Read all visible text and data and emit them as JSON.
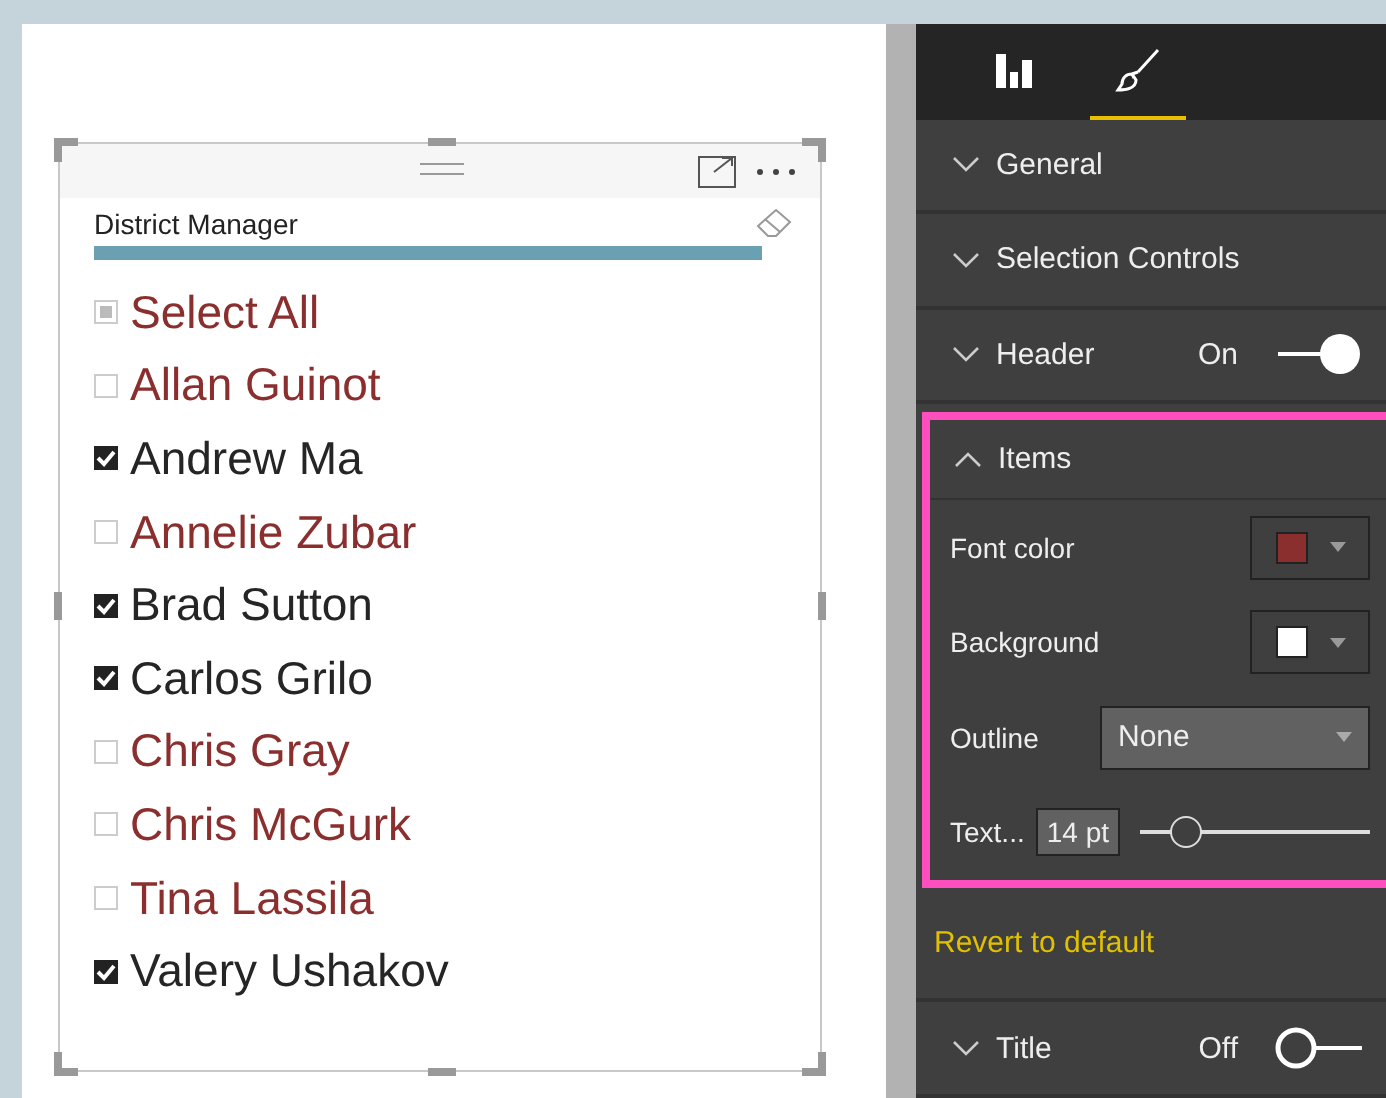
{
  "slicer": {
    "title": "District Manager",
    "select_all": {
      "label": "Select All",
      "indeterminate": true
    },
    "items": [
      {
        "label": "Allan Guinot",
        "checked": false
      },
      {
        "label": "Andrew Ma",
        "checked": true
      },
      {
        "label": "Annelie Zubar",
        "checked": false
      },
      {
        "label": "Brad Sutton",
        "checked": true
      },
      {
        "label": "Carlos Grilo",
        "checked": true
      },
      {
        "label": "Chris Gray",
        "checked": false
      },
      {
        "label": "Chris McGurk",
        "checked": false
      },
      {
        "label": "Tina Lassila",
        "checked": false
      },
      {
        "label": "Valery Ushakov",
        "checked": true
      }
    ]
  },
  "pane": {
    "tabs": [
      {
        "kind": "fields",
        "selected": false
      },
      {
        "kind": "format",
        "selected": true
      }
    ],
    "sections": [
      {
        "label": "General",
        "expanded": false
      },
      {
        "label": "Selection Controls",
        "expanded": false
      },
      {
        "label": "Header",
        "expanded": false,
        "toggle": {
          "label": "On",
          "on": true
        }
      }
    ],
    "items_card": {
      "label": "Items",
      "expanded": true,
      "font_color": {
        "label": "Font color",
        "color": "#8b2e2e"
      },
      "background": {
        "label": "Background",
        "color": "#ffffff"
      },
      "outline": {
        "label": "Outline",
        "value": "None"
      },
      "text_size": {
        "label": "Text...",
        "value": "14 pt",
        "level": 0.2
      }
    },
    "revert": "Revert to default",
    "title_section": {
      "label": "Title",
      "expanded": false,
      "toggle": {
        "label": "Off",
        "on": false
      }
    }
  }
}
